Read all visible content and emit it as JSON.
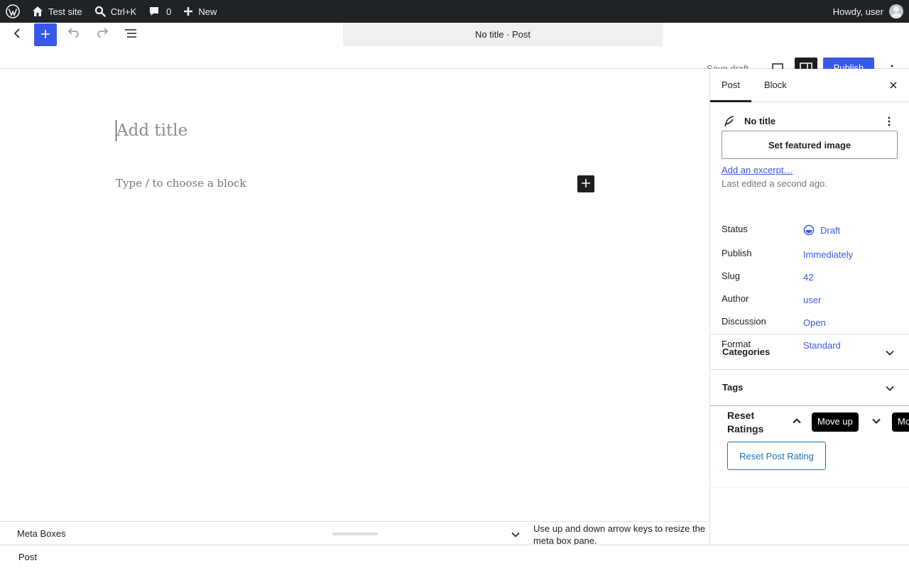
{
  "admin_bar": {
    "wp_logo_icon": "wordpress-logo-icon",
    "site_name": "Test site",
    "search_shortcut": "Ctrl+K",
    "comments_count": "0",
    "new_label": "New",
    "greeting": "Howdy, user"
  },
  "header": {
    "document_title": "No title · Post",
    "save_draft": "Save draft",
    "publish": "Publish"
  },
  "canvas": {
    "title_placeholder": "Add title",
    "block_placeholder": "Type / to choose a block"
  },
  "sidebar": {
    "tabs": [
      "Post",
      "Block"
    ],
    "post_title": "No title",
    "featured_image_button": "Set featured image",
    "excerpt_link": "Add an excerpt…",
    "last_edited": "Last edited a second ago.",
    "rows": [
      {
        "key": "Status",
        "value": "Draft"
      },
      {
        "key": "Publish",
        "value": "Immediately"
      },
      {
        "key": "Slug",
        "value": "42"
      },
      {
        "key": "Author",
        "value": "user"
      },
      {
        "key": "Discussion",
        "value": "Open"
      },
      {
        "key": "Format",
        "value": "Standard"
      }
    ],
    "panels": [
      "Categories",
      "Tags"
    ],
    "metabox": {
      "title": "Reset Ratings",
      "tooltip_up": "Move up",
      "tooltip_down": "Mo",
      "button": "Reset Post Rating"
    }
  },
  "meta_bar": {
    "label": "Meta Boxes",
    "help": "Use up and down arrow keys to resize the meta box pane."
  },
  "footer": {
    "breadcrumb": "Post"
  },
  "colors": {
    "accent": "#3858e9",
    "admin_bar": "#1d2327",
    "metabox_button": "#2271b1"
  }
}
